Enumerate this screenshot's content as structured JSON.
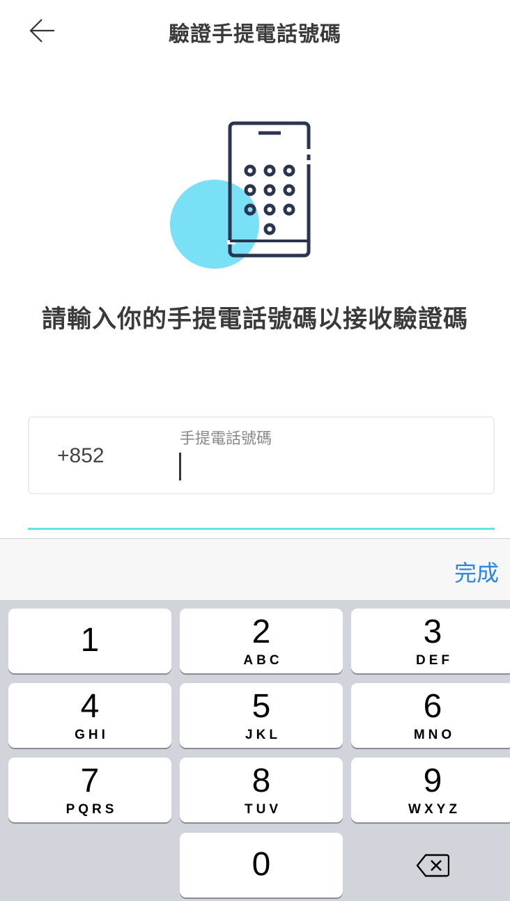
{
  "header": {
    "title": "驗證手提電話號碼",
    "back_icon": "arrow-left-icon"
  },
  "illustration": {
    "icon": "phone-keypad-icon",
    "accent_color": "#7ae0f5",
    "stroke_color": "#2b3550"
  },
  "prompt": "請輸入你的手提電話號碼以接收驗證碼",
  "phone_form": {
    "country_code": "+852",
    "field_label": "手提電話號碼",
    "value": "",
    "placeholder": ""
  },
  "accent_color": "#5de6e2",
  "keyboard": {
    "done_label": "完成",
    "keys": [
      {
        "digit": "1",
        "letters": ""
      },
      {
        "digit": "2",
        "letters": "ABC"
      },
      {
        "digit": "3",
        "letters": "DEF"
      },
      {
        "digit": "4",
        "letters": "GHI"
      },
      {
        "digit": "5",
        "letters": "JKL"
      },
      {
        "digit": "6",
        "letters": "MNO"
      },
      {
        "digit": "7",
        "letters": "PQRS"
      },
      {
        "digit": "8",
        "letters": "TUV"
      },
      {
        "digit": "9",
        "letters": "WXYZ"
      },
      {
        "digit": "0",
        "letters": ""
      }
    ],
    "delete_icon": "backspace-icon"
  }
}
